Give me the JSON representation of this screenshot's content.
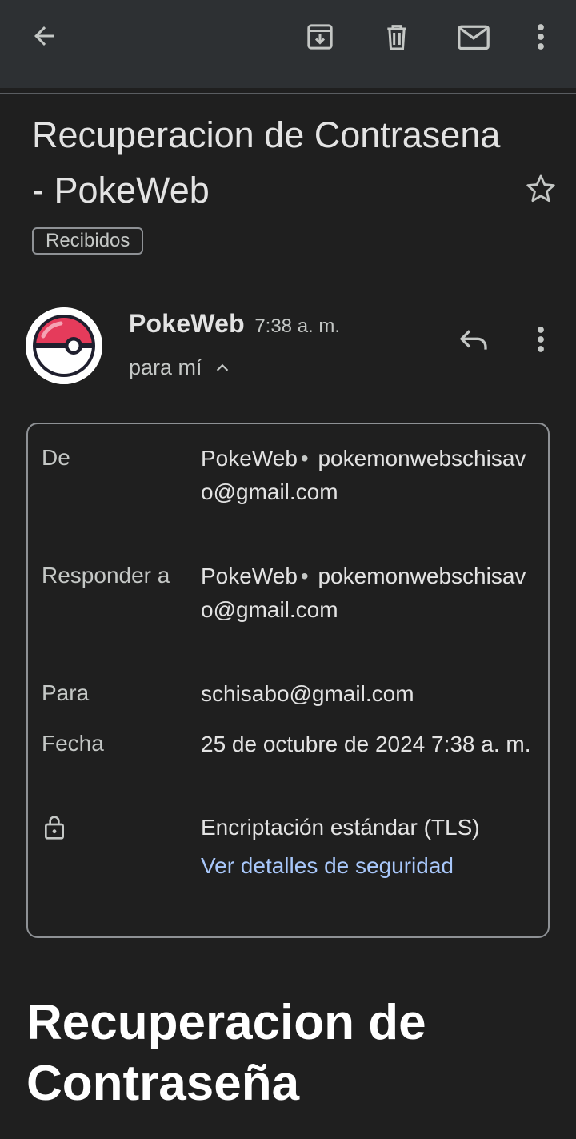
{
  "toolbar": {
    "back_icon": "arrow-left-icon",
    "archive_icon": "archive-icon",
    "delete_icon": "trash-icon",
    "mark_unread_icon": "mail-icon",
    "more_icon": "more-vert-icon"
  },
  "email": {
    "subject": "Recuperacion de Contrasena - PokeWeb",
    "label": "Recibidos",
    "sender_name": "PokeWeb",
    "time": "7:38 a. m.",
    "recipient_summary": "para mí",
    "details": {
      "from_label": "De",
      "from_name": "PokeWeb",
      "from_email": "pokemonwebschisavo@gmail.com",
      "reply_label": "Responder a",
      "reply_name": "PokeWeb",
      "reply_email": "pokemonwebschisavo@gmail.com",
      "to_label": "Para",
      "to_value": "schisabo@gmail.com",
      "date_label": "Fecha",
      "date_value": "25 de octubre de 2024 7:38 a. m.",
      "encryption": "Encriptación estándar (TLS)",
      "security_link": "Ver detalles de seguridad"
    },
    "body_title": "Recuperacion de Contraseña"
  },
  "colors": {
    "background": "#1f1f1f",
    "appbar": "#2d3033",
    "link": "#a8c7fa",
    "pokeball_red": "#e53b5b"
  }
}
